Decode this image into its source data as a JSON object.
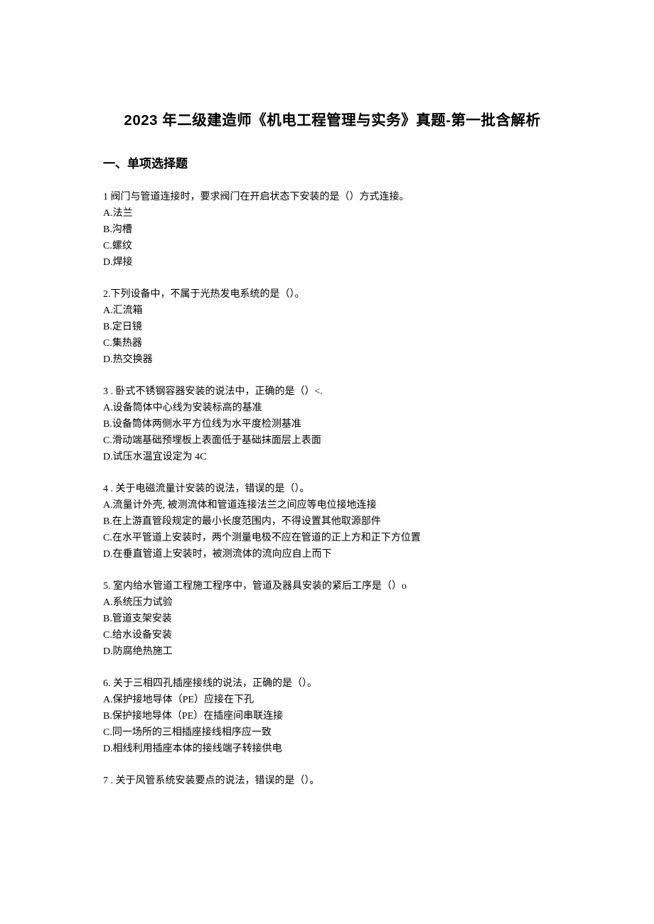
{
  "title": "2023 年二级建造师《机电工程管理与实务》真题-第一批含解析",
  "sectionHeading": "一、单项选择题",
  "questions": [
    {
      "stem": "1 阀门与管道连接时，要求阀门在开启状态下安装的是（）方式连接。",
      "options": [
        "A.法兰",
        "B.沟槽",
        "C.螺纹",
        "D.焊接"
      ]
    },
    {
      "stem": "2.下列设备中，不属于光热发电系统的是（）。",
      "options": [
        "A.汇流箱",
        "B.定日镜",
        "C.集热器",
        "D.热交换器"
      ]
    },
    {
      "stem": "3 . 卧式不锈钢容器安装的说法中，正确的是（）<.",
      "options": [
        "A.设备筒体中心线为安装标高的基准",
        "B.设备筒体两侧水平方位线为水平度检测基准",
        "C.滑动端基础预埋板上表面低于基础抹面层上表面",
        "D.试压水温宜设定为 4C"
      ]
    },
    {
      "stem": "4 . 关于电磁流量计安装的说法，错误的是（）。",
      "options": [
        "A.流量计外壳, 被测流体和管道连接法兰之间应等电位接地连接",
        "B.在上游直管段规定的最小长度范围内，不得设置其他取源部件",
        "C.在水平管道上安装时，两个测量电极不应在管道的正上方和正下方位置",
        "D.在垂直管道上安装时，被测流体的流向应自上而下"
      ]
    },
    {
      "stem": "5. 室内给水管道工程施工程序中，管道及器具安装的紧后工序是（）o",
      "options": [
        "A.系统压力试验",
        "B.管道支架安装",
        "C.给水设备安装",
        "D.防腐绝热施工"
      ]
    },
    {
      "stem": "6. 关于三相四孔插座接线的说法，正确的是（）。",
      "options": [
        "A.保护接地导体（PE）应接在下孔",
        "B.保护接地导体（PE）在插座间串联连接",
        "C.同一场所的三相插座接线相序应一致",
        "D.相线利用插座本体的接线端子转接供电"
      ]
    },
    {
      "stem": "7 . 关于风管系统安装要点的说法，错误的是（）。",
      "options": []
    }
  ]
}
